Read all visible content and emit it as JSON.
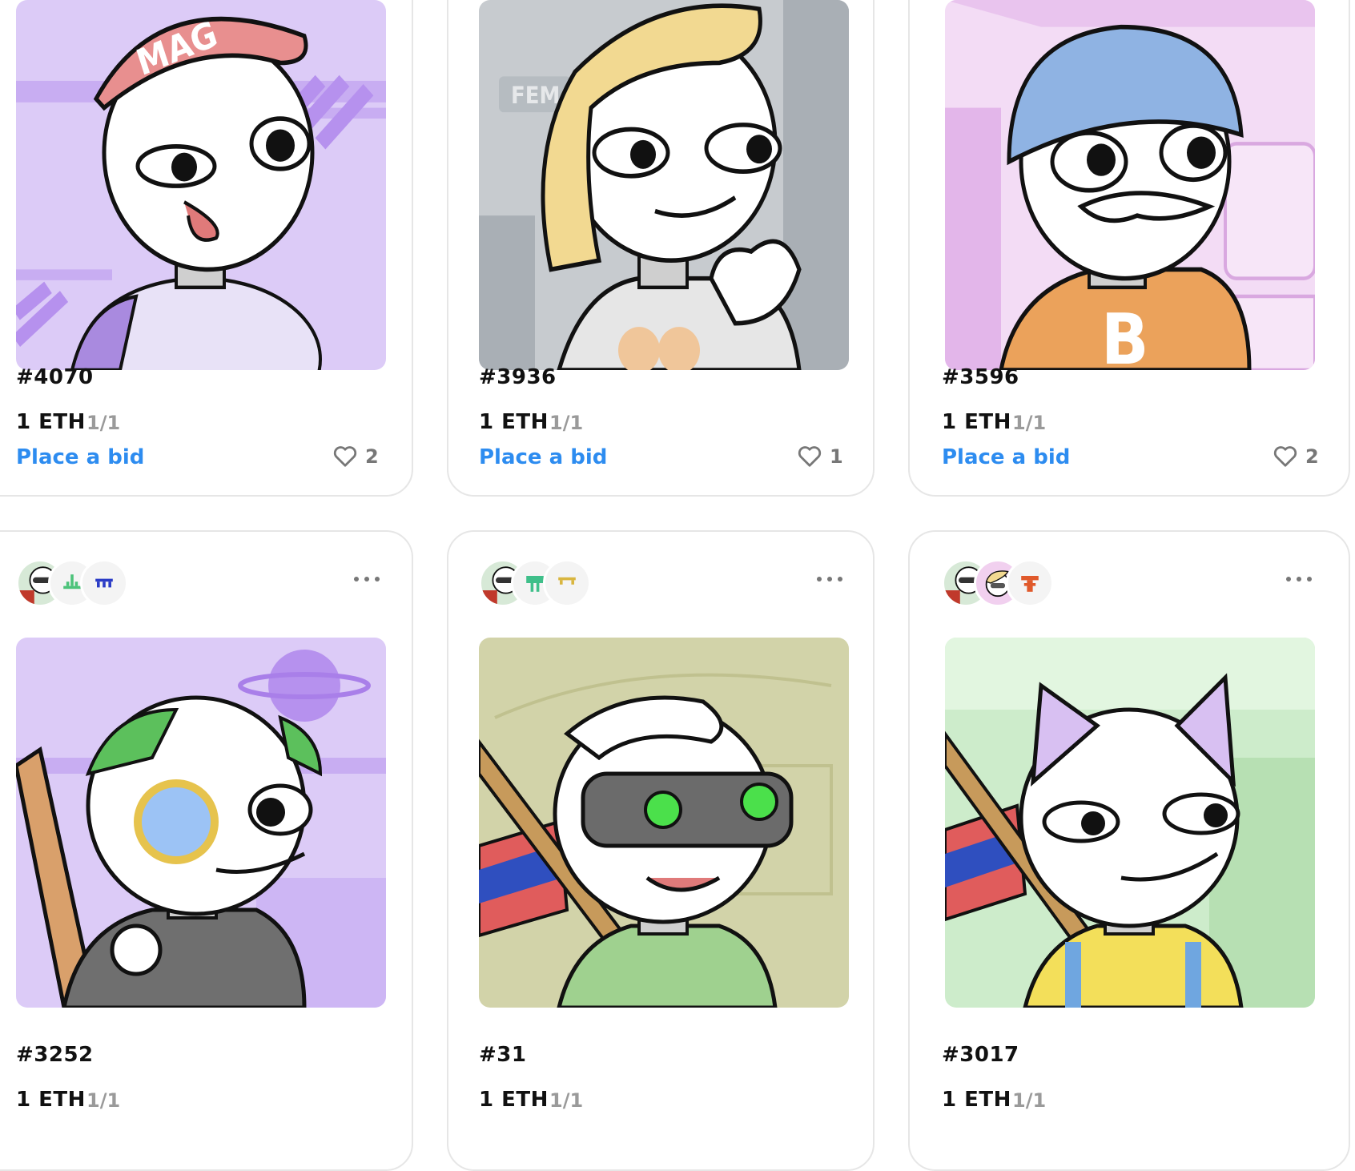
{
  "cards": [
    {
      "title": "#4070",
      "price": "1 ETH",
      "edition": "1/1",
      "bid_label": "Place a bid",
      "likes": "2"
    },
    {
      "title": "#3936",
      "price": "1 ETH",
      "edition": "1/1",
      "bid_label": "Place a bid",
      "likes": "1"
    },
    {
      "title": "#3596",
      "price": "1 ETH",
      "edition": "1/1",
      "bid_label": "Place a bid",
      "likes": "2"
    },
    {
      "title": "#3252",
      "price": "1 ETH",
      "edition": "1/1"
    },
    {
      "title": "#31",
      "price": "1 ETH",
      "edition": "1/1"
    },
    {
      "title": "#3017",
      "price": "1 ETH",
      "edition": "1/1"
    }
  ],
  "art_logos": {
    "hat_text": "MAGA",
    "sweater_logo": "B",
    "poster_text": "FEM"
  },
  "colors": {
    "link": "#2d8cf0",
    "border": "#e6e6e6",
    "muted": "#9a9a9a"
  },
  "icons": [
    "heart-icon",
    "more-options-icon",
    "creator-avatar",
    "owner-avatar",
    "collection-avatar"
  ]
}
